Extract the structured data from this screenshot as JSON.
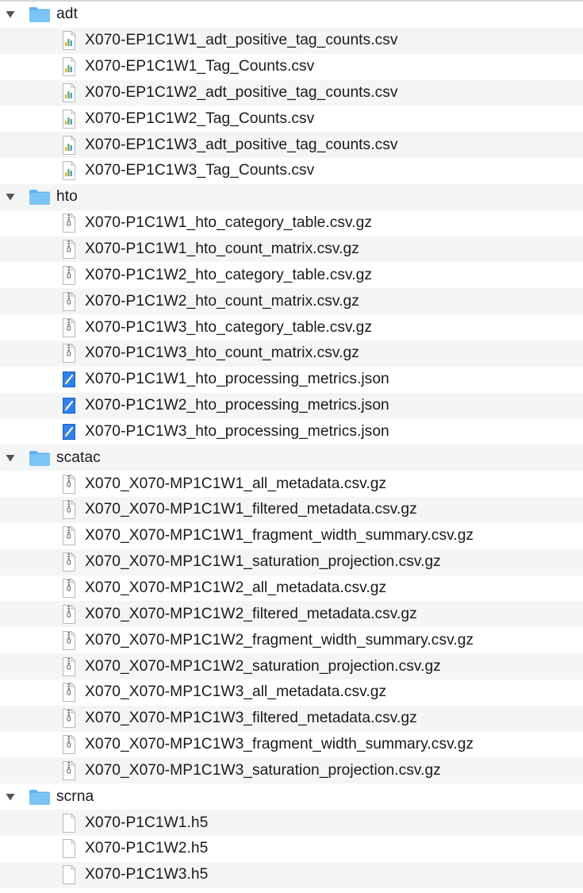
{
  "folders": [
    {
      "name": "adt",
      "files": [
        {
          "name": "X070-EP1C1W1_adt_positive_tag_counts.csv",
          "icon": "spreadsheet-icon"
        },
        {
          "name": "X070-EP1C1W1_Tag_Counts.csv",
          "icon": "spreadsheet-icon"
        },
        {
          "name": "X070-EP1C1W2_adt_positive_tag_counts.csv",
          "icon": "spreadsheet-icon"
        },
        {
          "name": "X070-EP1C1W2_Tag_Counts.csv",
          "icon": "spreadsheet-icon"
        },
        {
          "name": "X070-EP1C1W3_adt_positive_tag_counts.csv",
          "icon": "spreadsheet-icon"
        },
        {
          "name": "X070-EP1C1W3_Tag_Counts.csv",
          "icon": "spreadsheet-icon"
        }
      ]
    },
    {
      "name": "hto",
      "files": [
        {
          "name": "X070-P1C1W1_hto_category_table.csv.gz",
          "icon": "archive-icon"
        },
        {
          "name": "X070-P1C1W1_hto_count_matrix.csv.gz",
          "icon": "archive-icon"
        },
        {
          "name": "X070-P1C1W2_hto_category_table.csv.gz",
          "icon": "archive-icon"
        },
        {
          "name": "X070-P1C1W2_hto_count_matrix.csv.gz",
          "icon": "archive-icon"
        },
        {
          "name": "X070-P1C1W3_hto_category_table.csv.gz",
          "icon": "archive-icon"
        },
        {
          "name": "X070-P1C1W3_hto_count_matrix.csv.gz",
          "icon": "archive-icon"
        },
        {
          "name": "X070-P1C1W1_hto_processing_metrics.json",
          "icon": "json-icon"
        },
        {
          "name": "X070-P1C1W2_hto_processing_metrics.json",
          "icon": "json-icon"
        },
        {
          "name": "X070-P1C1W3_hto_processing_metrics.json",
          "icon": "json-icon"
        }
      ]
    },
    {
      "name": "scatac",
      "files": [
        {
          "name": "X070_X070-MP1C1W1_all_metadata.csv.gz",
          "icon": "archive-icon"
        },
        {
          "name": "X070_X070-MP1C1W1_filtered_metadata.csv.gz",
          "icon": "archive-icon"
        },
        {
          "name": "X070_X070-MP1C1W1_fragment_width_summary.csv.gz",
          "icon": "archive-icon"
        },
        {
          "name": "X070_X070-MP1C1W1_saturation_projection.csv.gz",
          "icon": "archive-icon"
        },
        {
          "name": "X070_X070-MP1C1W2_all_metadata.csv.gz",
          "icon": "archive-icon"
        },
        {
          "name": "X070_X070-MP1C1W2_filtered_metadata.csv.gz",
          "icon": "archive-icon"
        },
        {
          "name": "X070_X070-MP1C1W2_fragment_width_summary.csv.gz",
          "icon": "archive-icon"
        },
        {
          "name": "X070_X070-MP1C1W2_saturation_projection.csv.gz",
          "icon": "archive-icon"
        },
        {
          "name": "X070_X070-MP1C1W3_all_metadata.csv.gz",
          "icon": "archive-icon"
        },
        {
          "name": "X070_X070-MP1C1W3_filtered_metadata.csv.gz",
          "icon": "archive-icon"
        },
        {
          "name": "X070_X070-MP1C1W3_fragment_width_summary.csv.gz",
          "icon": "archive-icon"
        },
        {
          "name": "X070_X070-MP1C1W3_saturation_projection.csv.gz",
          "icon": "archive-icon"
        }
      ]
    },
    {
      "name": "scrna",
      "files": [
        {
          "name": "X070-P1C1W1.h5",
          "icon": "document-icon"
        },
        {
          "name": "X070-P1C1W2.h5",
          "icon": "document-icon"
        },
        {
          "name": "X070-P1C1W3.h5",
          "icon": "document-icon"
        }
      ]
    }
  ],
  "colors": {
    "stripe": "#f4f5f5",
    "folder": "#7cc4f5",
    "folder_tab": "#5fb2ee",
    "text": "#1a1a1a"
  }
}
